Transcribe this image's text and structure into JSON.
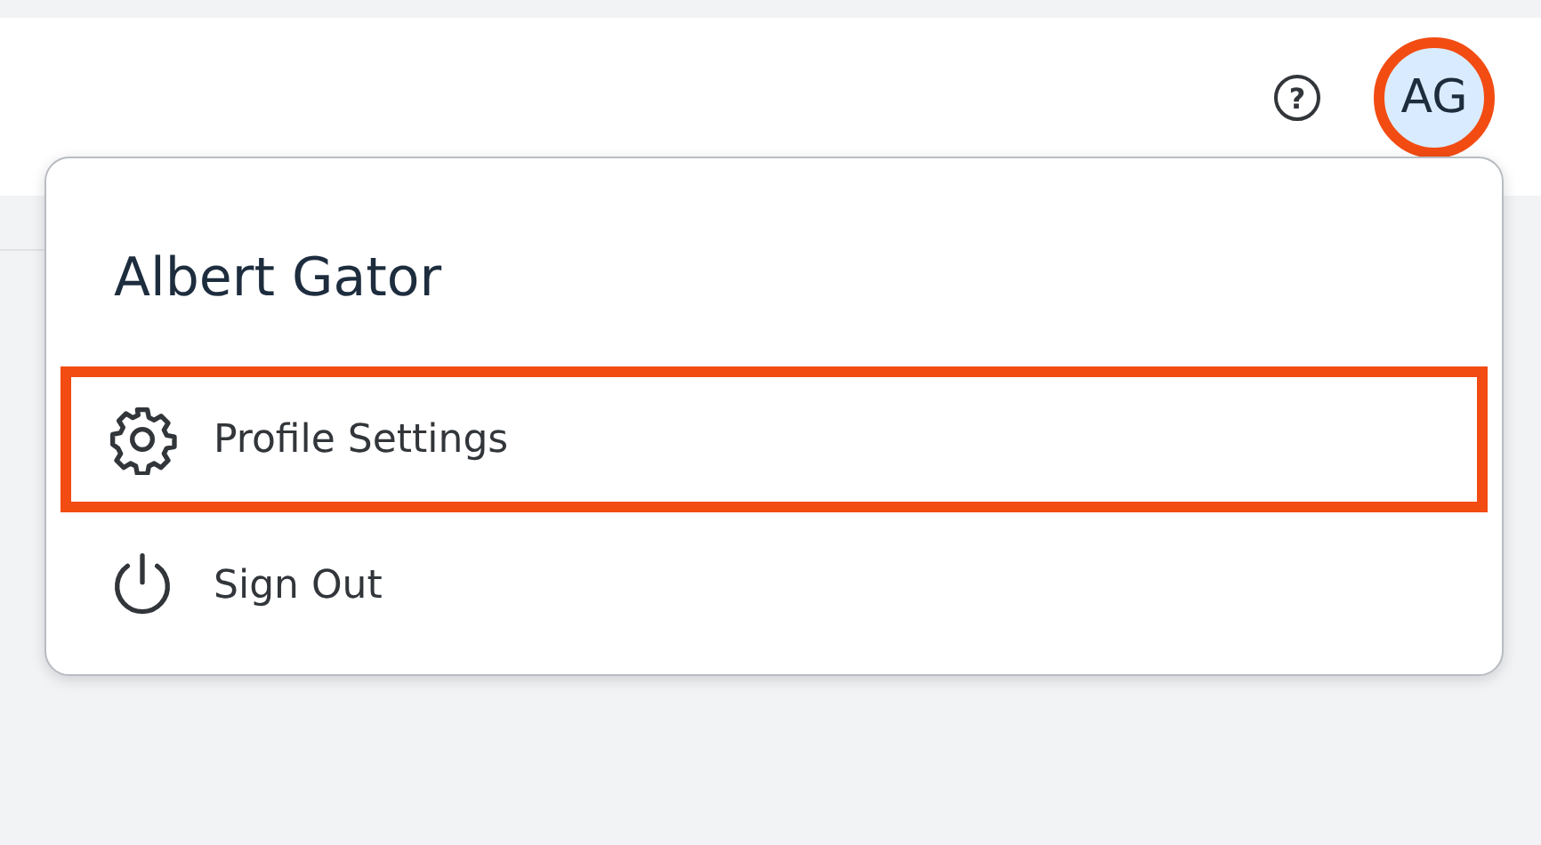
{
  "header": {
    "help_icon": "?",
    "avatar": {
      "initials": "AG",
      "highlighted": true
    }
  },
  "user_menu": {
    "name": "Albert Gator",
    "items": [
      {
        "kind": "settings",
        "label": "Profile Settings",
        "highlighted": true
      },
      {
        "kind": "signout",
        "label": "Sign Out",
        "highlighted": false
      }
    ]
  }
}
